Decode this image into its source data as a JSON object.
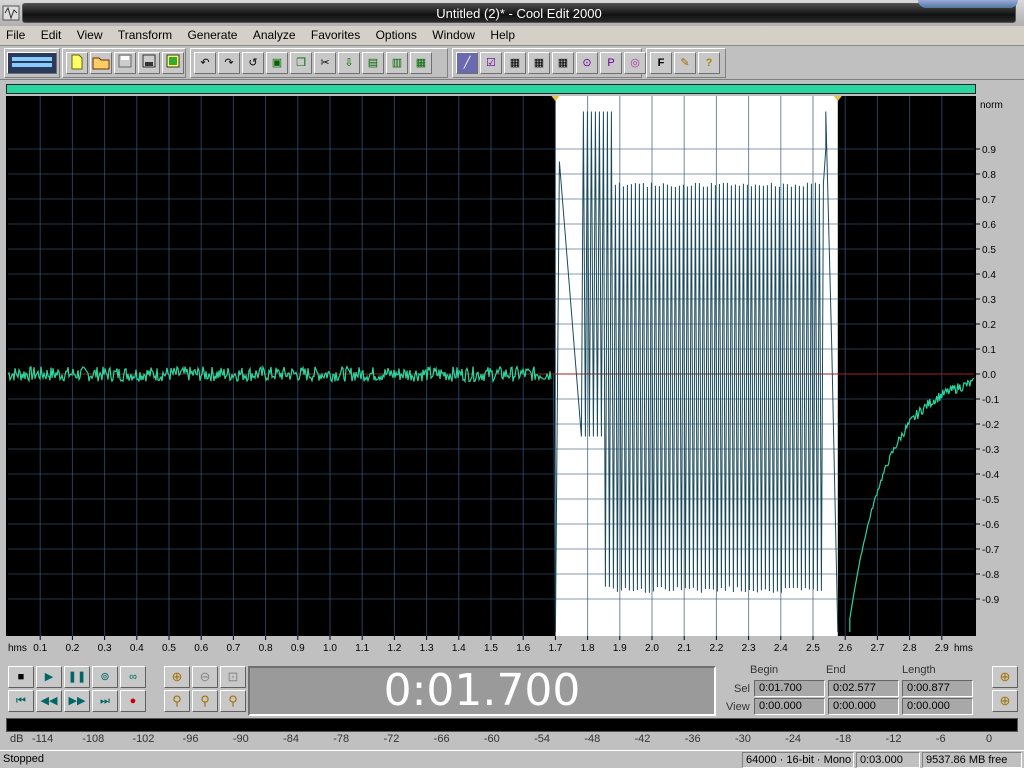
{
  "window": {
    "title": "Untitled (2)* - Cool Edit 2000"
  },
  "menu": [
    "File",
    "Edit",
    "View",
    "Transform",
    "Generate",
    "Analyze",
    "Favorites",
    "Options",
    "Window",
    "Help"
  ],
  "toolbar": {
    "icons": [
      "multitrack-view-icon",
      "new-file-icon",
      "open-file-icon",
      "save-icon",
      "save-selection-icon",
      "close-icon",
      "undo-icon",
      "redo-icon",
      "repeat-last-icon",
      "trim-icon",
      "copy-icon",
      "cut-icon",
      "paste-icon",
      "paste-new-icon",
      "mix-paste-icon",
      "paste-to-new-icon",
      "loop-icon",
      "spectral-view-icon",
      "waveform-view-icon",
      "grid-icon",
      "grid-icon-2",
      "grid-icon-3",
      "grid-icon-4",
      "analyze-icon",
      "properties-icon",
      "cd-icon",
      "favorites-f-icon",
      "notes-icon",
      "help-icon"
    ],
    "labels": {
      "favorites": "F",
      "help": "?"
    }
  },
  "waveform": {
    "yaxis_title": "norm",
    "yticks": [
      "0.9",
      "0.8",
      "0.7",
      "0.6",
      "0.5",
      "0.4",
      "0.3",
      "0.2",
      "0.1",
      "0.0",
      "-0.1",
      "-0.2",
      "-0.3",
      "-0.4",
      "-0.5",
      "-0.6",
      "-0.7",
      "-0.8",
      "-0.9"
    ],
    "xaxis_unit": "hms",
    "xticks": [
      "0.1",
      "0.2",
      "0.3",
      "0.4",
      "0.5",
      "0.6",
      "0.7",
      "0.8",
      "0.9",
      "1.0",
      "1.1",
      "1.2",
      "1.3",
      "1.4",
      "1.5",
      "1.6",
      "1.7",
      "1.8",
      "1.9",
      "2.0",
      "2.1",
      "2.2",
      "2.3",
      "2.4",
      "2.5",
      "2.6",
      "2.7",
      "2.8",
      "2.9"
    ],
    "selection_start": 1.7,
    "selection_end": 2.577,
    "duration": 3.0,
    "wave_color": "#2ad6a0",
    "selected_wave_color": "#1a4a5a",
    "background": "#000000",
    "selection_background": "#ffffff",
    "grid_color": "#3a5a7a"
  },
  "transport": {
    "time_display": "0:01.700",
    "buttons": [
      "stop",
      "play",
      "pause",
      "play-to-end",
      "loop",
      "go-to-beginning",
      "rewind",
      "fast-forward",
      "go-to-end",
      "record"
    ]
  },
  "selection_panel": {
    "headers": {
      "begin": "Begin",
      "end": "End",
      "length": "Length"
    },
    "rows": [
      {
        "label": "Sel",
        "begin": "0:01.700",
        "end": "0:02.577",
        "length": "0:00.877"
      },
      {
        "label": "View",
        "begin": "0:00.000",
        "end": "0:00.000",
        "length": "0:00.000"
      }
    ]
  },
  "level_meter": {
    "unit": "dB",
    "ticks": [
      "-114",
      "-108",
      "-102",
      "-96",
      "-90",
      "-84",
      "-78",
      "-72",
      "-66",
      "-60",
      "-54",
      "-48",
      "-42",
      "-36",
      "-30",
      "-24",
      "-18",
      "-12",
      "-6",
      "0"
    ]
  },
  "status": {
    "state": "Stopped",
    "format": "64000 · 16-bit · Mono",
    "file_length": "0:03.000",
    "free_space": "9537.86 MB free"
  }
}
